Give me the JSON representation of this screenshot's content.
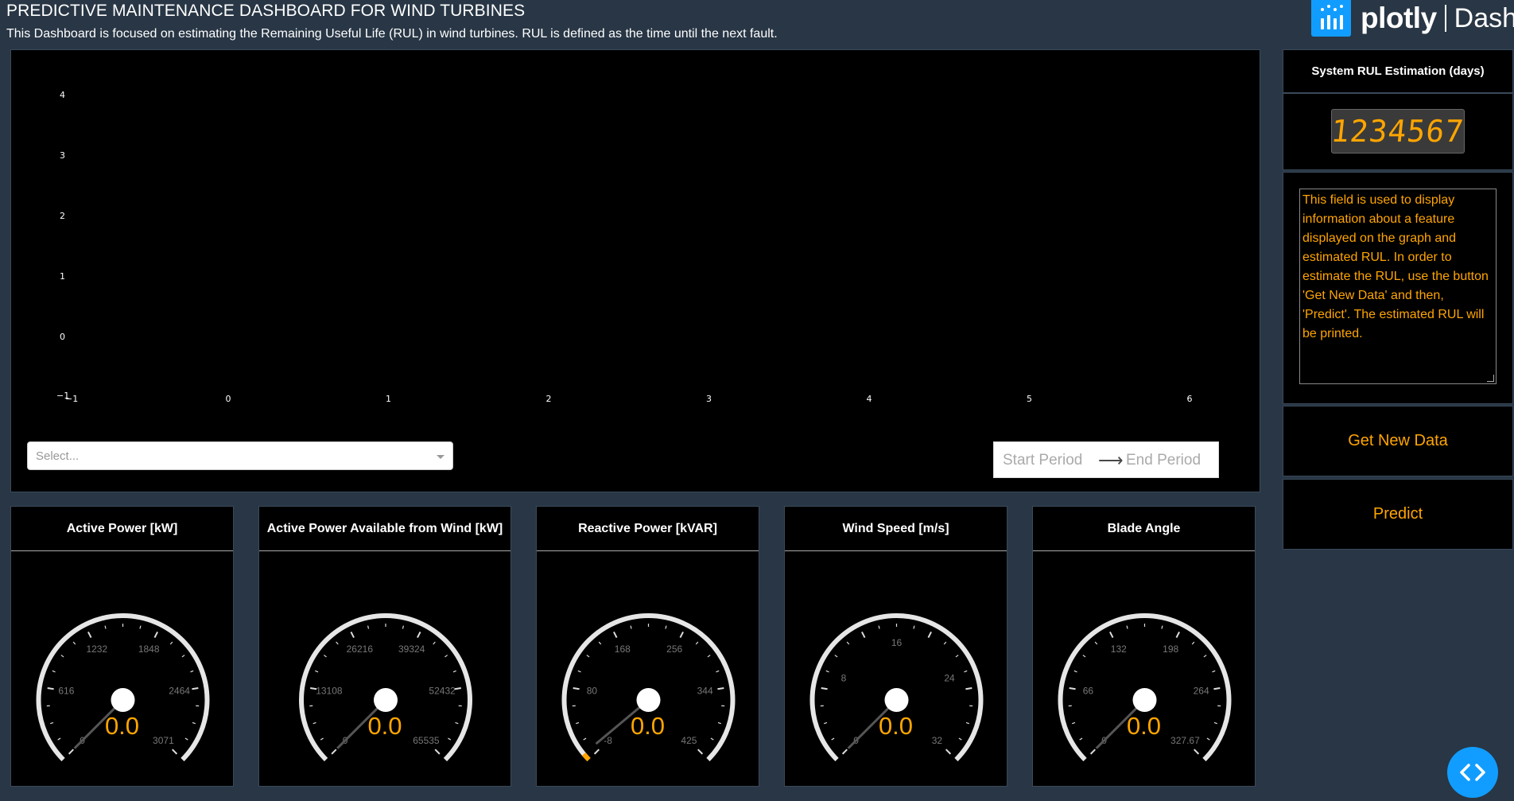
{
  "header": {
    "title": "PREDICTIVE MAINTENANCE DASHBOARD FOR WIND TURBINES",
    "subtitle": "This Dashboard is focused on estimating the Remaining Useful Life (RUL) in wind turbines. RUL is defined as the time until the next fault.",
    "logo_word": "plotly",
    "logo_dash": "Dash"
  },
  "graph": {
    "y_ticks": [
      "4",
      "3",
      "2",
      "1",
      "0",
      "−1"
    ],
    "x_ticks": [
      "−1",
      "0",
      "1",
      "2",
      "3",
      "4",
      "5",
      "6"
    ],
    "feature_select_placeholder": "Select...",
    "date_start_placeholder": "Start Period",
    "date_end_placeholder": "End Period",
    "date_arrow": "⟶"
  },
  "rul": {
    "title": "System RUL Estimation (days)",
    "led_value": "1234567",
    "info_text": "This field is used to display information about a feature displayed on the graph and estimated RUL. In order to estimate the RUL, use the button 'Get New Data' and then, 'Predict'. The estimated RUL will be printed."
  },
  "buttons": {
    "get_new_data": "Get New Data",
    "predict": "Predict"
  },
  "gauges": [
    {
      "label": "Active Power [kW]",
      "value": "0.0",
      "ticks": [
        "0",
        "616",
        "1232",
        "1848",
        "2464",
        "3071"
      ],
      "level": 0
    },
    {
      "label": "Active Power Available from Wind [kW]",
      "value": "0.0",
      "ticks": [
        "0",
        "13108",
        "26216",
        "39324",
        "52432",
        "65535"
      ],
      "level": 0
    },
    {
      "label": "Reactive Power [kVAR]",
      "value": "0.0",
      "ticks": [
        "-8",
        "80",
        "168",
        "256",
        "344",
        "425"
      ],
      "level": 0.019
    },
    {
      "label": "Wind Speed [m/s]",
      "value": "0.0",
      "ticks": [
        "0",
        "8",
        "16",
        "24",
        "32"
      ],
      "level": 0
    },
    {
      "label": "Blade Angle",
      "value": "0.0",
      "ticks": [
        "0",
        "66",
        "132",
        "198",
        "264",
        "327.67"
      ],
      "level": 0
    }
  ],
  "colors": {
    "background": "#283645",
    "panel": "#000000",
    "accent": "#ffa500",
    "dash_blue": "#119dff"
  },
  "icons": {
    "dropdown": "chevron-down-icon",
    "nav": "code-brackets-icon"
  }
}
